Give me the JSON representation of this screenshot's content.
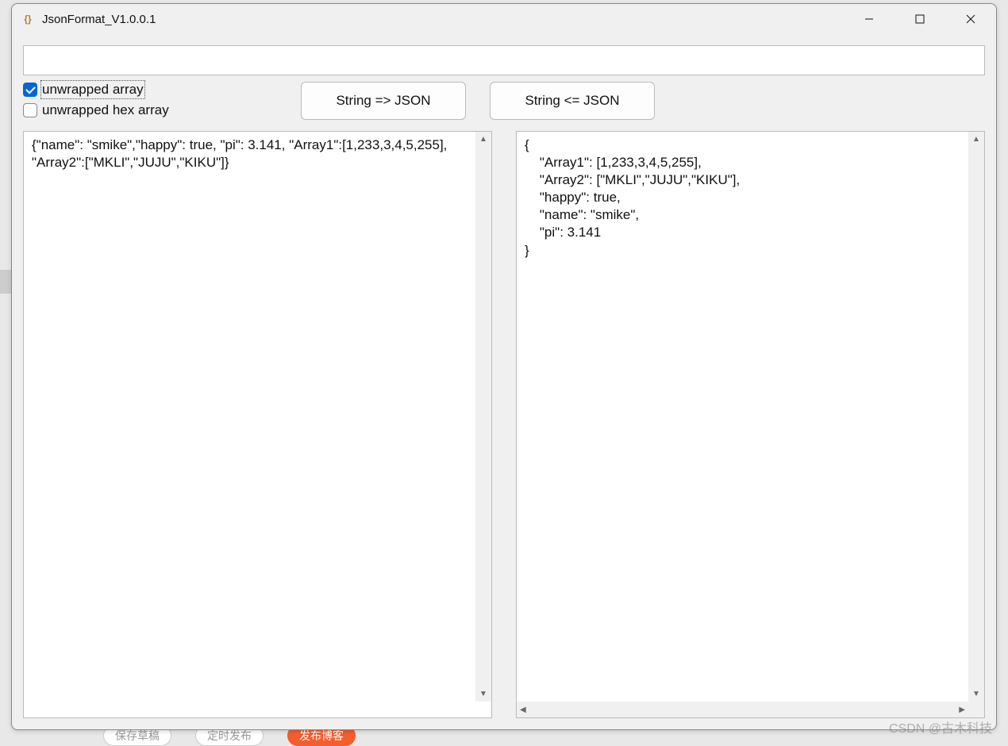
{
  "window": {
    "title": "JsonFormat_V1.0.0.1"
  },
  "topInput": {
    "value": ""
  },
  "checkboxes": {
    "unwrappedArray": {
      "label": "unwrapped array",
      "checked": true
    },
    "unwrappedHexArray": {
      "label": "unwrapped hex array",
      "checked": false
    }
  },
  "buttons": {
    "toJson": "String => JSON",
    "fromJson": "String <= JSON"
  },
  "panes": {
    "left": "{\"name\": \"smike\",\"happy\": true, \"pi\": 3.141, \"Array1\":[1,233,3,4,5,255], \"Array2\":[\"MKLI\",\"JUJU\",\"KIKU\"]}",
    "right": "{\n    \"Array1\": [1,233,3,4,5,255],\n    \"Array2\": [\"MKLI\",\"JUJU\",\"KIKU\"],\n    \"happy\": true,\n    \"name\": \"smike\",\n    \"pi\": 3.141\n}"
  },
  "watermark": "CSDN @古木科技",
  "background": {
    "pill1": "保存草稿",
    "pill2": "定时发布",
    "pill3": "发布博客"
  }
}
